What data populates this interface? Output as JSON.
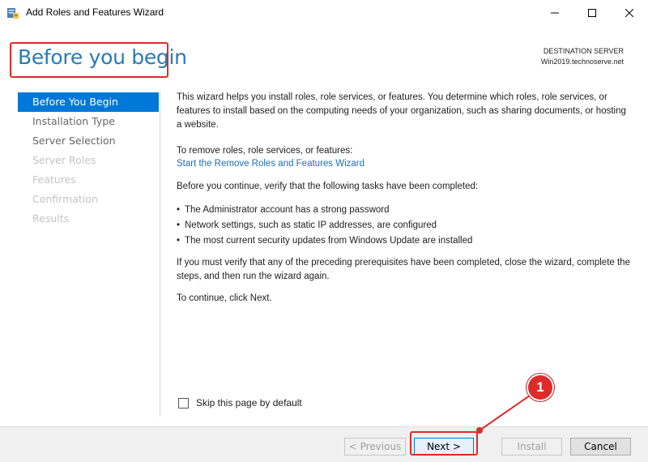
{
  "window": {
    "title": "Add Roles and Features Wizard"
  },
  "header": {
    "title": "Before you begin",
    "destination_label": "DESTINATION SERVER",
    "destination_server": "Win2019.technoserve.net"
  },
  "sidebar": {
    "items": [
      {
        "label": "Before You Begin",
        "state": "active"
      },
      {
        "label": "Installation Type",
        "state": "enabled"
      },
      {
        "label": "Server Selection",
        "state": "enabled"
      },
      {
        "label": "Server Roles",
        "state": "disabled"
      },
      {
        "label": "Features",
        "state": "disabled"
      },
      {
        "label": "Confirmation",
        "state": "disabled"
      },
      {
        "label": "Results",
        "state": "disabled"
      }
    ]
  },
  "content": {
    "intro": "This wizard helps you install roles, role services, or features. You determine which roles, role services, or features to install based on the computing needs of your organization, such as sharing documents, or hosting a website.",
    "remove_text": "To remove roles, role services, or features:",
    "remove_link": "Start the Remove Roles and Features Wizard",
    "verify_text": "Before you continue, verify that the following tasks have been completed:",
    "bullets": [
      "The Administrator account has a strong password",
      "Network settings, such as static IP addresses, are configured",
      "The most current security updates from Windows Update are installed"
    ],
    "must_verify": "If you must verify that any of the preceding prerequisites have been completed, close the wizard, complete the steps, and then run the wizard again.",
    "continue_text": "To continue, click Next.",
    "skip_label": "Skip this page by default"
  },
  "footer": {
    "previous_label": "< Previous",
    "next_label": "Next >",
    "install_label": "Install",
    "cancel_label": "Cancel"
  },
  "annotation": {
    "badge": "1"
  },
  "colors": {
    "accent": "#0078d7",
    "title_blue": "#2a7ab3",
    "highlight_red": "#e02a2a"
  }
}
